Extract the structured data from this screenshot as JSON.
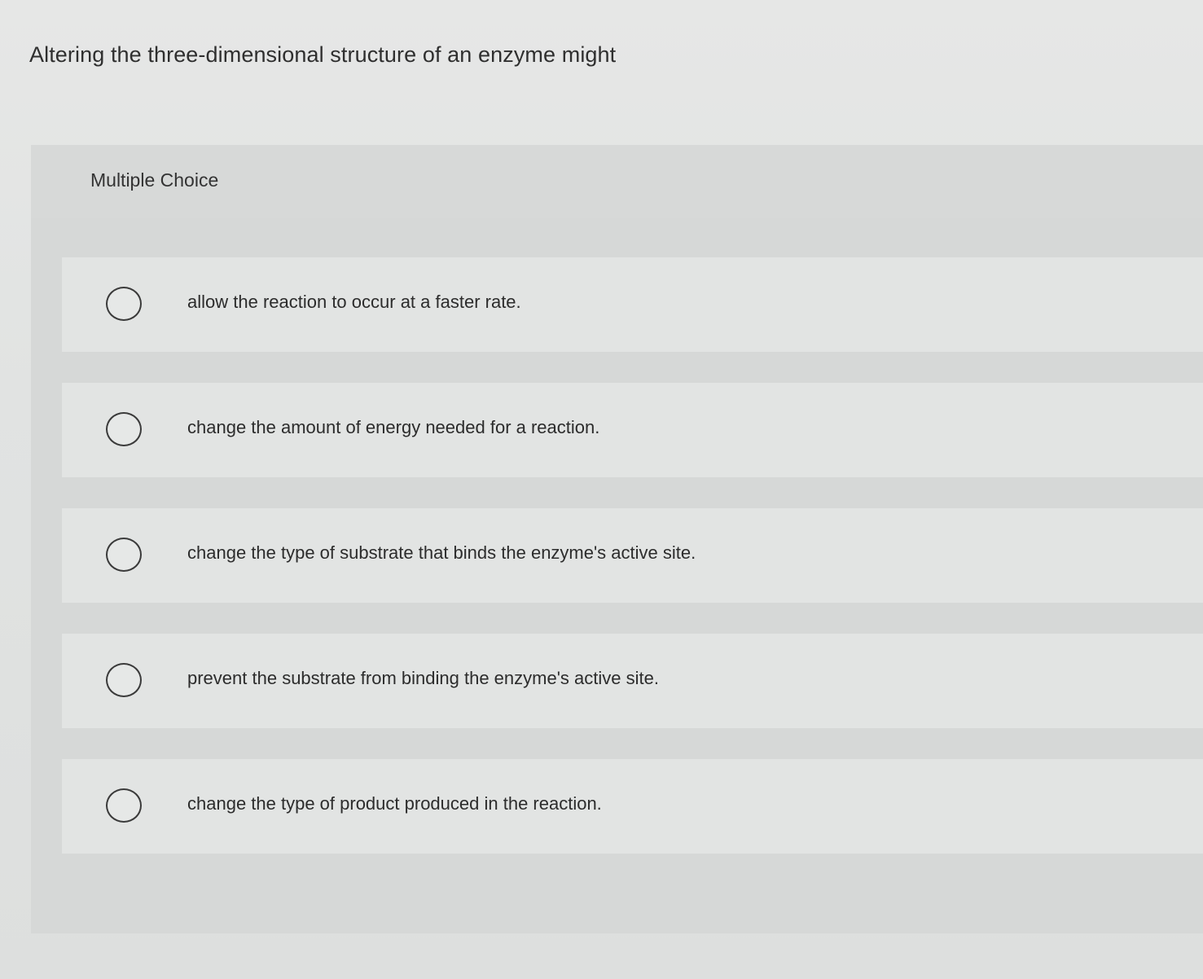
{
  "question": {
    "stem": "Altering the three-dimensional structure of an enzyme might",
    "type_label": "Multiple Choice"
  },
  "options": [
    {
      "label": "allow the reaction to occur at a faster rate."
    },
    {
      "label": "change the amount of energy needed for a reaction."
    },
    {
      "label": "change the type of substrate that binds the enzyme's active site."
    },
    {
      "label": "prevent the substrate from binding the enzyme's active site."
    },
    {
      "label": "change the type of product produced in the reaction."
    }
  ]
}
